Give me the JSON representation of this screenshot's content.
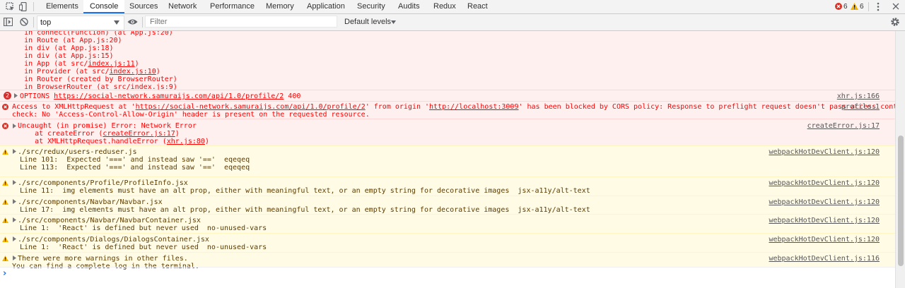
{
  "tabs": [
    "Elements",
    "Console",
    "Sources",
    "Network",
    "Performance",
    "Memory",
    "Application",
    "Security",
    "Audits",
    "Redux",
    "React"
  ],
  "active_tab": "Console",
  "counts": {
    "errors": "6",
    "warnings": "6"
  },
  "toolbar": {
    "context": "top",
    "filter_placeholder": "Filter",
    "levels": "Default levels"
  },
  "messages": {
    "stack": {
      "lines": [
        "    in connect(Function) (at App.js:20)",
        "    in Route (at App.js:20)",
        "    in div (at App.js:18)",
        "    in div (at App.js:15)",
        "    in App (at src/",
        "    in Provider (at src/",
        "    in Router (created by BrowserRouter)",
        "    in BrowserRouter (at src/"
      ],
      "links": [
        "",
        "",
        "",
        "",
        "index.js:11",
        "index.js:10",
        "",
        "index.js:9"
      ],
      "tails": [
        "",
        "",
        "",
        "",
        ")",
        ")",
        "",
        ")"
      ]
    },
    "options": {
      "count": "2",
      "pre": "OPTIONS ",
      "url": "https://social-network.samuraijs.com/api/1.0/profile/2",
      "status": " 400",
      "source": "xhr.js:166"
    },
    "cors": {
      "l1a": "Access to XMLHttpRequest at '",
      "l1url": "https://social-network.samuraijs.com/api/1.0/profile/2",
      "l1b": "' from origin '",
      "l1origin": "http://localhost:3009",
      "l1c": "' has been blocked by CORS policy: Response to preflight request doesn't pass access control",
      "l2": "check: No 'Access-Control-Allow-Origin' header is present on the requested resource.",
      "source": "profile:1"
    },
    "uncaught": {
      "l1": "Uncaught (in promise) Error: Network Error",
      "l2a": "    at createError (",
      "l2link": "createError.js:17",
      "l2b": ")",
      "l3a": "    at XMLHttpRequest.handleError (",
      "l3link": "xhr.js:80",
      "l3b": ")",
      "source": "createError.js:17"
    },
    "warnings": [
      {
        "title": "./src/redux/users-reduser.js",
        "lines": [
          "Line 101:  Expected '===' and instead saw '=='  eqeqeq",
          "Line 113:  Expected '===' and instead saw '=='  eqeqeq"
        ],
        "source": "webpackHotDevClient.js:120"
      },
      {
        "title": "./src/components/Profile/ProfileInfo.jsx",
        "lines": [
          "Line 11:  img elements must have an alt prop, either with meaningful text, or an empty string for decorative images  jsx-a11y/alt-text"
        ],
        "source": "webpackHotDevClient.js:120"
      },
      {
        "title": "./src/components/Navbar/Navbar.jsx",
        "lines": [
          "Line 17:  img elements must have an alt prop, either with meaningful text, or an empty string for decorative images  jsx-a11y/alt-text"
        ],
        "source": "webpackHotDevClient.js:120"
      },
      {
        "title": "./src/components/Navbar/NavbarContainer.jsx",
        "lines": [
          "Line 1:  'React' is defined but never used  no-unused-vars"
        ],
        "source": "webpackHotDevClient.js:120"
      },
      {
        "title": "./src/components/Dialogs/DialogsContainer.jsx",
        "lines": [
          "Line 1:  'React' is defined but never used  no-unused-vars"
        ],
        "source": "webpackHotDevClient.js:120"
      },
      {
        "title": "There were more warnings in other files.",
        "lines": [
          "You can find a complete log in the terminal."
        ],
        "source": "webpackHotDevClient.js:116"
      }
    ]
  },
  "prompt_symbol": "›"
}
